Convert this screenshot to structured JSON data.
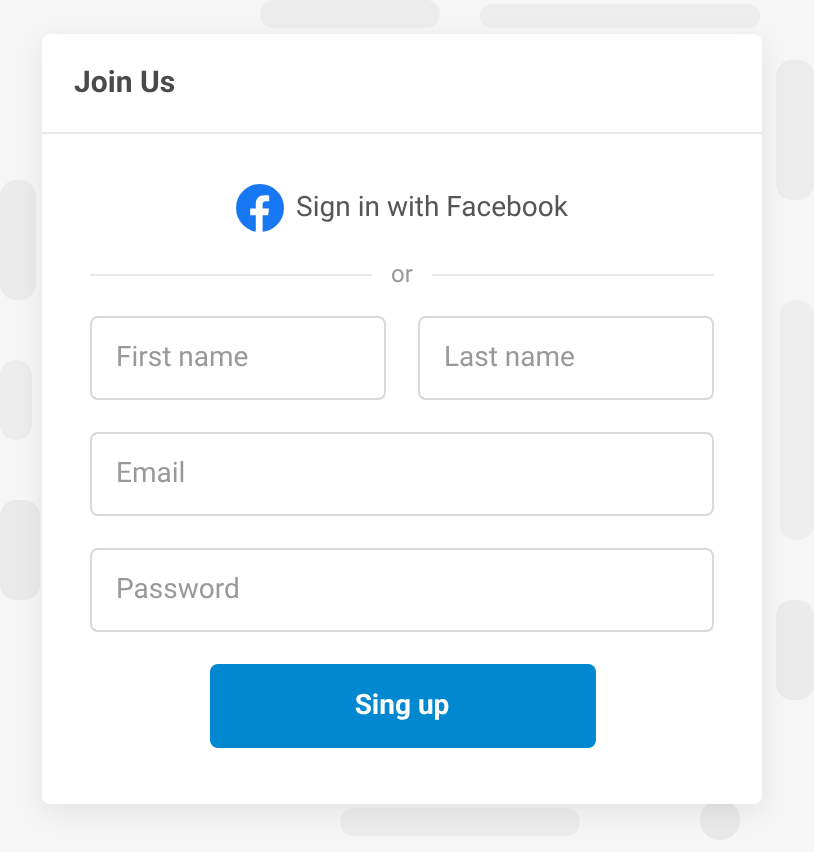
{
  "card": {
    "title": "Join Us"
  },
  "facebook_button": {
    "label": "Sign in with Facebook"
  },
  "divider": {
    "label": "or"
  },
  "fields": [
    {
      "placeholder": "First name"
    },
    {
      "placeholder": "Last name"
    },
    {
      "placeholder": "Email"
    },
    {
      "placeholder": "Password"
    }
  ],
  "submit_button": {
    "label": "Sing up"
  }
}
